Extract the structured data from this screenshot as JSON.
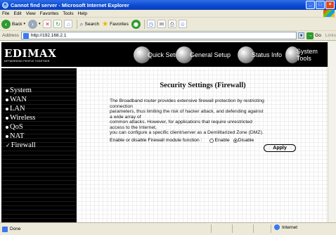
{
  "window": {
    "title": "Cannot find server - Microsoft Internet Explorer",
    "controls": {
      "minimize": "_",
      "maximize": "□",
      "close": "×"
    }
  },
  "menu": [
    "File",
    "Edit",
    "View",
    "Favorites",
    "Tools",
    "Help"
  ],
  "toolbar": {
    "back_label": "Back",
    "search_label": "Search",
    "favorites_label": "Favorites"
  },
  "address": {
    "label": "Address",
    "url": "http://192.168.2.1",
    "go_label": "Go",
    "links_label": "Links"
  },
  "banner": {
    "logo": "EDIMAX",
    "tagline": "NETWORKING PEOPLE TOGETHER",
    "nav": [
      "Quick Setup",
      "General Setup",
      "Status Info",
      "System Tools"
    ]
  },
  "sidebar": {
    "items": [
      {
        "label": "System",
        "marker": "bullet"
      },
      {
        "label": "WAN",
        "marker": "bullet"
      },
      {
        "label": "LAN",
        "marker": "bullet"
      },
      {
        "label": "Wireless",
        "marker": "bullet"
      },
      {
        "label": "QoS",
        "marker": "bullet"
      },
      {
        "label": "NAT",
        "marker": "bullet"
      },
      {
        "label": "Firewall",
        "marker": "check"
      }
    ]
  },
  "main": {
    "title": "Security Settings (Firewall)",
    "description_lines": [
      "The Broadband router provides extensive firewall protection by restricting",
      "connection",
      "parameters, thus limiting the risk of hacker attack, and defending against",
      "a wide array of",
      "common attacks. However, for applications that require unrestricted",
      "access to the Internet,",
      "you can configure a specific client/server as a Demilitarized Zone (DMZ)."
    ],
    "firewall_label": "Enable or disable Firewall module function :",
    "enable_label": "Enable",
    "disable_label": "Disable",
    "selected": "Disable",
    "apply_label": "Apply"
  },
  "status": {
    "text": "Done",
    "zone": "Internet"
  }
}
